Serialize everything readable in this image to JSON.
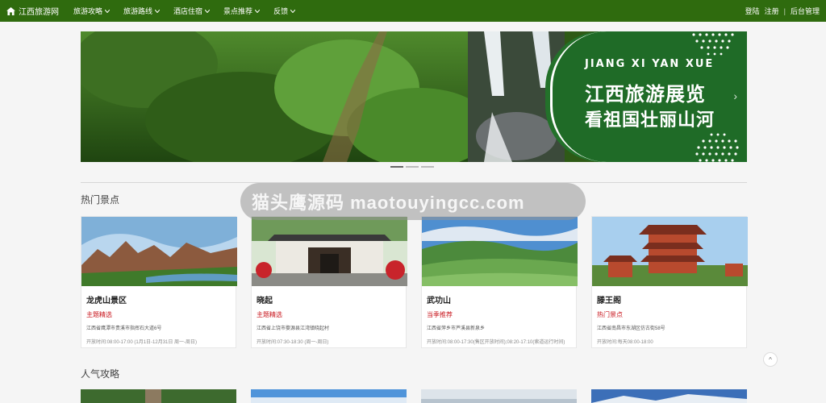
{
  "nav": {
    "brand": "江西旅游网",
    "items": [
      "旅游攻略",
      "旅游路线",
      "酒店住宿",
      "景点推荐",
      "反馈"
    ],
    "login": "登陆",
    "register": "注册",
    "separator": "|",
    "admin": "后台管理"
  },
  "banner": {
    "subtitle": "JIANG XI YAN XUE",
    "title_line1": "江西旅游展览",
    "title_line2": "看祖国壮丽山河",
    "arrow": "›"
  },
  "watermark": {
    "text": "猫头鹰源码 maotouyingcc.com"
  },
  "sections": {
    "hot_spots": "热门景点",
    "popular_guides": "人气攻略"
  },
  "cards": [
    {
      "name": "龙虎山景区",
      "tag": "主题精选",
      "address": "江西省鹰潭市贵溪市指挥石大道6号",
      "hours": "开放时间:08:00-17:00 (1月1日-12月31日 周一-周日)"
    },
    {
      "name": "晓起",
      "tag": "主题精选",
      "address": "江西省上饶市婺源县江湾镇晓起村",
      "hours": "开放时间:07:30-18:30 (周一-周日)"
    },
    {
      "name": "武功山",
      "tag": "当季推荐",
      "address": "江西省萍乡市芦溪县新泉乡",
      "hours": "开放时间:08:00-17:30(售区开放时间);08:20-17:10(索道运行时间)"
    },
    {
      "name": "滕王阁",
      "tag": "热门景点",
      "address": "江西省南昌市东湖区仿古街58号",
      "hours": "开放时间:每天08:00-18:00"
    }
  ],
  "back_to_top": "^",
  "colors": {
    "nav_bg": "#2f6b0e",
    "tag_red": "#c8161d",
    "banner_green": "#1f6b27"
  }
}
